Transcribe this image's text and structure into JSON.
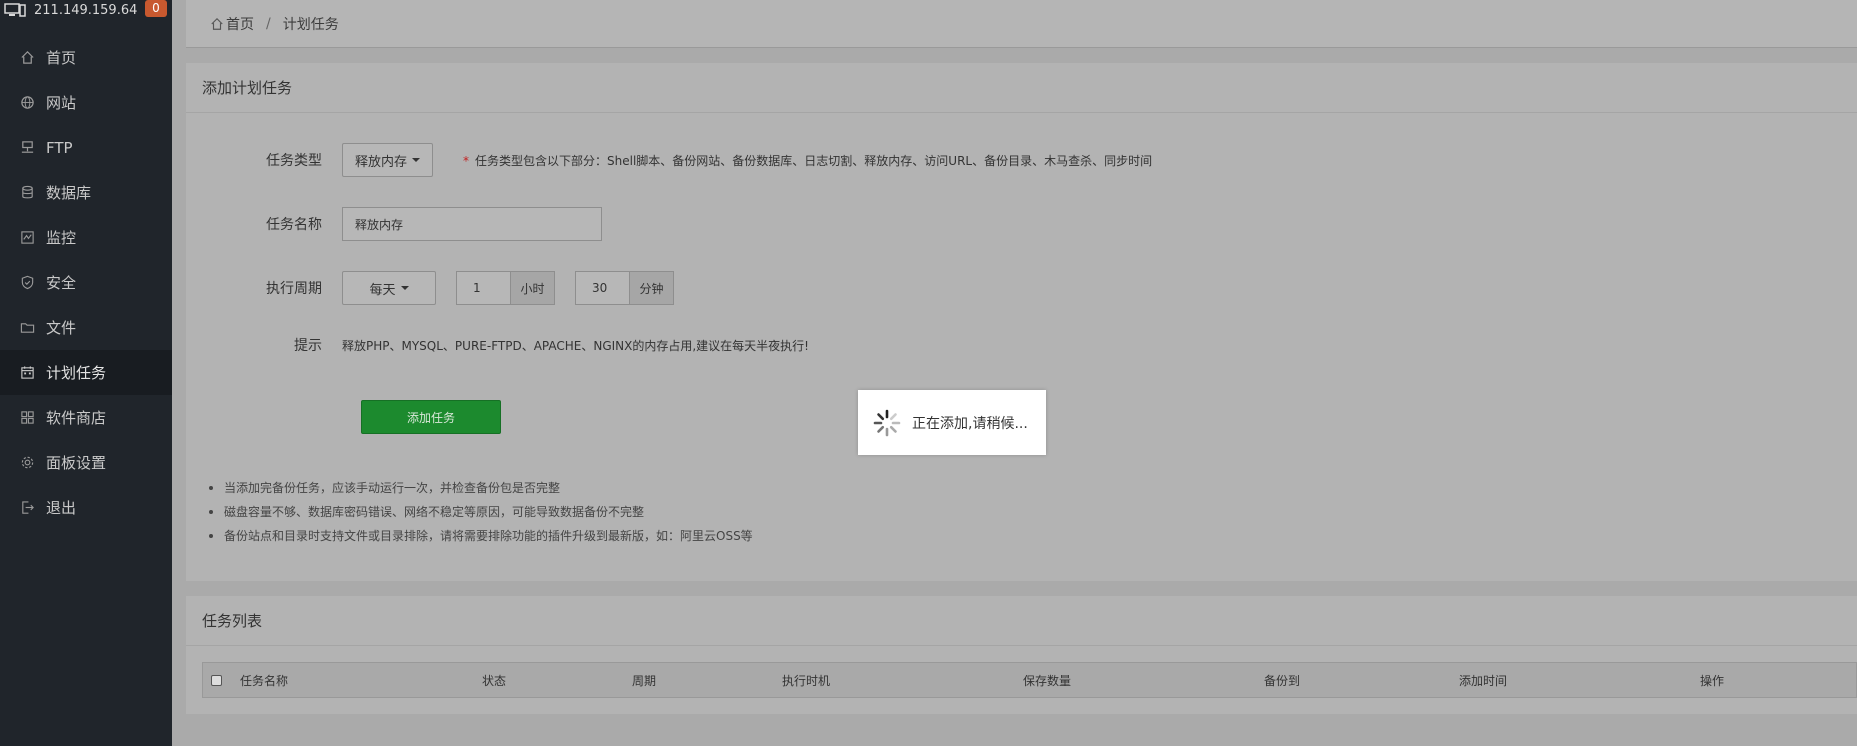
{
  "server": {
    "ip": "211.149.159.64",
    "alerts": "0"
  },
  "sidebar": {
    "items": [
      {
        "label": "首页",
        "icon": "home-icon"
      },
      {
        "label": "网站",
        "icon": "globe-icon"
      },
      {
        "label": "FTP",
        "icon": "ftp-icon"
      },
      {
        "label": "数据库",
        "icon": "database-icon"
      },
      {
        "label": "监控",
        "icon": "monitor-icon"
      },
      {
        "label": "安全",
        "icon": "shield-icon"
      },
      {
        "label": "文件",
        "icon": "folder-icon"
      },
      {
        "label": "计划任务",
        "icon": "calendar-icon",
        "active": true
      },
      {
        "label": "软件商店",
        "icon": "grid-icon"
      },
      {
        "label": "面板设置",
        "icon": "gear-icon"
      },
      {
        "label": "退出",
        "icon": "logout-icon"
      }
    ]
  },
  "breadcrumb": {
    "home": "首页",
    "separator": "/",
    "current": "计划任务"
  },
  "add_panel": {
    "title": "添加计划任务",
    "task_type": {
      "label": "任务类型",
      "value": "释放内存",
      "hint_star": "*",
      "hint": "任务类型包含以下部分：Shell脚本、备份网站、备份数据库、日志切割、释放内存、访问URL、备份目录、木马查杀、同步时间"
    },
    "task_name": {
      "label": "任务名称",
      "value": "释放内存"
    },
    "period": {
      "label": "执行周期",
      "value": "每天",
      "hour": "1",
      "hour_unit": "小时",
      "minute": "30",
      "minute_unit": "分钟"
    },
    "tip": {
      "label": "提示",
      "text": "释放PHP、MYSQL、PURE-FTPD、APACHE、NGINX的内存占用,建议在每天半夜执行!"
    },
    "submit_label": "添加任务",
    "notes": [
      "当添加完备份任务，应该手动运行一次，并检查备份包是否完整",
      "磁盘容量不够、数据库密码错误、网络不稳定等原因，可能导致数据备份不完整",
      "备份站点和目录时支持文件或目录排除，请将需要排除功能的插件升级到最新版，如：阿里云OSS等"
    ]
  },
  "list_panel": {
    "title": "任务列表",
    "columns": [
      "任务名称",
      "状态",
      "周期",
      "执行时机",
      "保存数量",
      "备份到",
      "添加时间",
      "操作"
    ]
  },
  "loading": {
    "text": "正在添加,请稍候..."
  },
  "colors": {
    "sidebar_bg": "#20252b",
    "badge": "#c8592f",
    "submit": "#1c8a2e"
  }
}
